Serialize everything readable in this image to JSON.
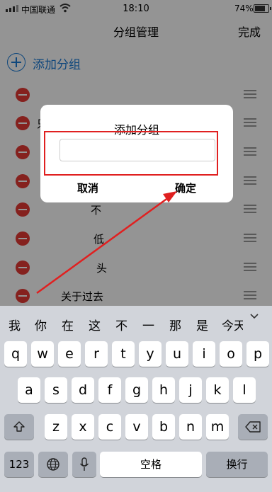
{
  "status_bar": {
    "carrier": "中国联通",
    "time": "18:10",
    "battery": "74%"
  },
  "nav": {
    "title": "分组管理",
    "done": "完成"
  },
  "add_group": {
    "label": "添加分组"
  },
  "groups": [
    "",
    "只",
    "",
    "",
    "不",
    "低",
    "头",
    "关于过去"
  ],
  "dialog": {
    "title": "添加分组",
    "input_value": "",
    "cancel": "取消",
    "ok": "确定"
  },
  "keyboard": {
    "candidates": [
      "我",
      "你",
      "在",
      "这",
      "不",
      "一",
      "那",
      "是",
      "今天"
    ],
    "row1": [
      "q",
      "w",
      "e",
      "r",
      "t",
      "y",
      "u",
      "i",
      "o",
      "p"
    ],
    "row2": [
      "a",
      "s",
      "d",
      "f",
      "g",
      "h",
      "j",
      "k",
      "l"
    ],
    "row3": [
      "z",
      "x",
      "c",
      "v",
      "b",
      "n",
      "m"
    ],
    "numbers_key": "123",
    "space_key": "空格",
    "return_key": "换行"
  },
  "colors": {
    "accent": "#1a7ad6",
    "delete": "#e53935",
    "annotation": "#e02020"
  }
}
